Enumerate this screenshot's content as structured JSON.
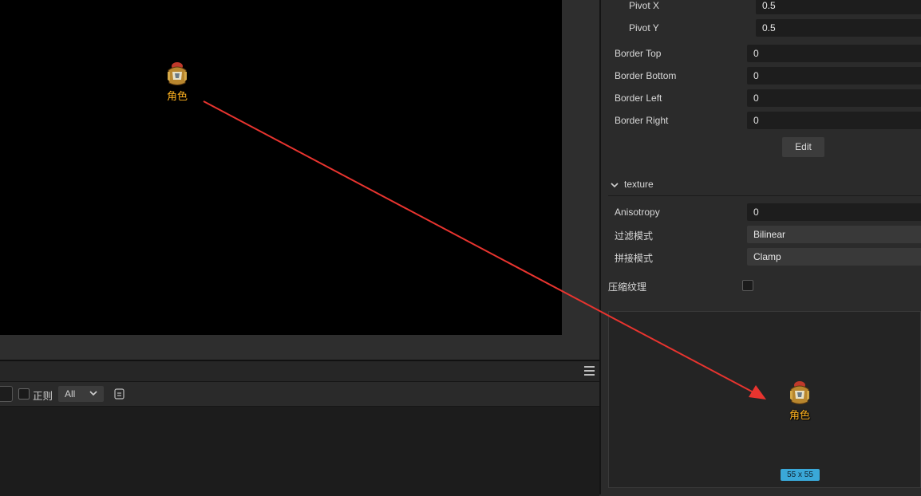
{
  "scene": {
    "asset_label": "角色",
    "icon": "character-helmet-icon"
  },
  "console": {
    "regex_label": "正则",
    "level_filter": "All",
    "icons": [
      "menu-icon",
      "chevron-down-icon",
      "clear-log-icon"
    ]
  },
  "inspector": {
    "pivot_x_label": "Pivot X",
    "pivot_x_value": "0.5",
    "pivot_y_label": "Pivot Y",
    "pivot_y_value": "0.5",
    "border_top_label": "Border Top",
    "border_top_value": "0",
    "border_bottom_label": "Border Bottom",
    "border_bottom_value": "0",
    "border_left_label": "Border Left",
    "border_left_value": "0",
    "border_right_label": "Border Right",
    "border_right_value": "0",
    "edit_label": "Edit",
    "texture_section_title": "texture",
    "anisotropy_label": "Anisotropy",
    "anisotropy_value": "0",
    "filter_mode_label": "过滤模式",
    "filter_mode_value": "Bilinear",
    "wrap_mode_label": "拼接模式",
    "wrap_mode_value": "Clamp",
    "compress_label": "压缩纹理",
    "compress_checked": false
  },
  "preview": {
    "asset_label": "角色",
    "size": "55 x 55"
  },
  "colors": {
    "annotation_arrow": "#e8342f",
    "asset_label": "#ffb21f",
    "size_badge": "#3aa8d8"
  }
}
